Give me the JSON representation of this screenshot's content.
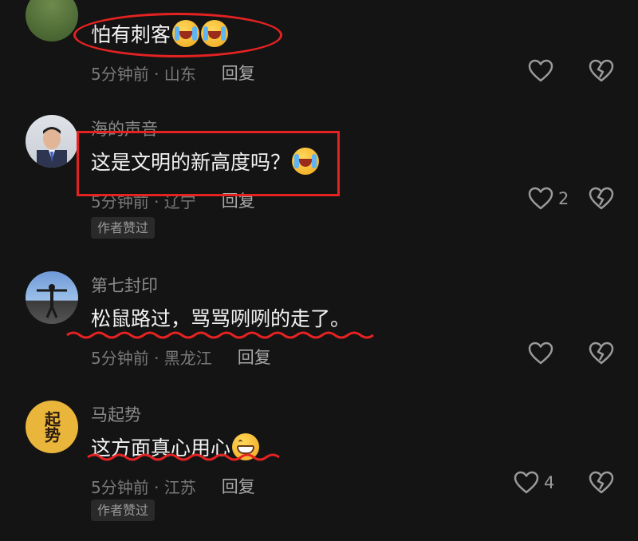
{
  "comments": [
    {
      "username": "",
      "text": "怕有刺客",
      "time": "5分钟前 · 山东",
      "reply": "回复",
      "likes": "",
      "badge": ""
    },
    {
      "username": "海的声音",
      "text": "这是文明的新高度吗？",
      "time": "5分钟前 · 辽宁",
      "reply": "回复",
      "likes": "2",
      "badge": "作者赞过"
    },
    {
      "username": "第七封印",
      "text": "松鼠路过，骂骂咧咧的走了。",
      "time": "5分钟前 · 黑龙江",
      "reply": "回复",
      "likes": "",
      "badge": ""
    },
    {
      "username": "马起势",
      "text": "这方面真心用心",
      "time": "5分钟前 · 江苏",
      "reply": "回复",
      "likes": "4",
      "badge": "作者赞过"
    }
  ],
  "avatars": {
    "c4_text": "起势"
  },
  "colors": {
    "background": "#141414",
    "annotation": "#e52222",
    "meta": "#7a7a7a"
  },
  "icons": [
    "heart-icon",
    "broken-heart-icon",
    "crying-emoji",
    "grinning-emoji"
  ]
}
